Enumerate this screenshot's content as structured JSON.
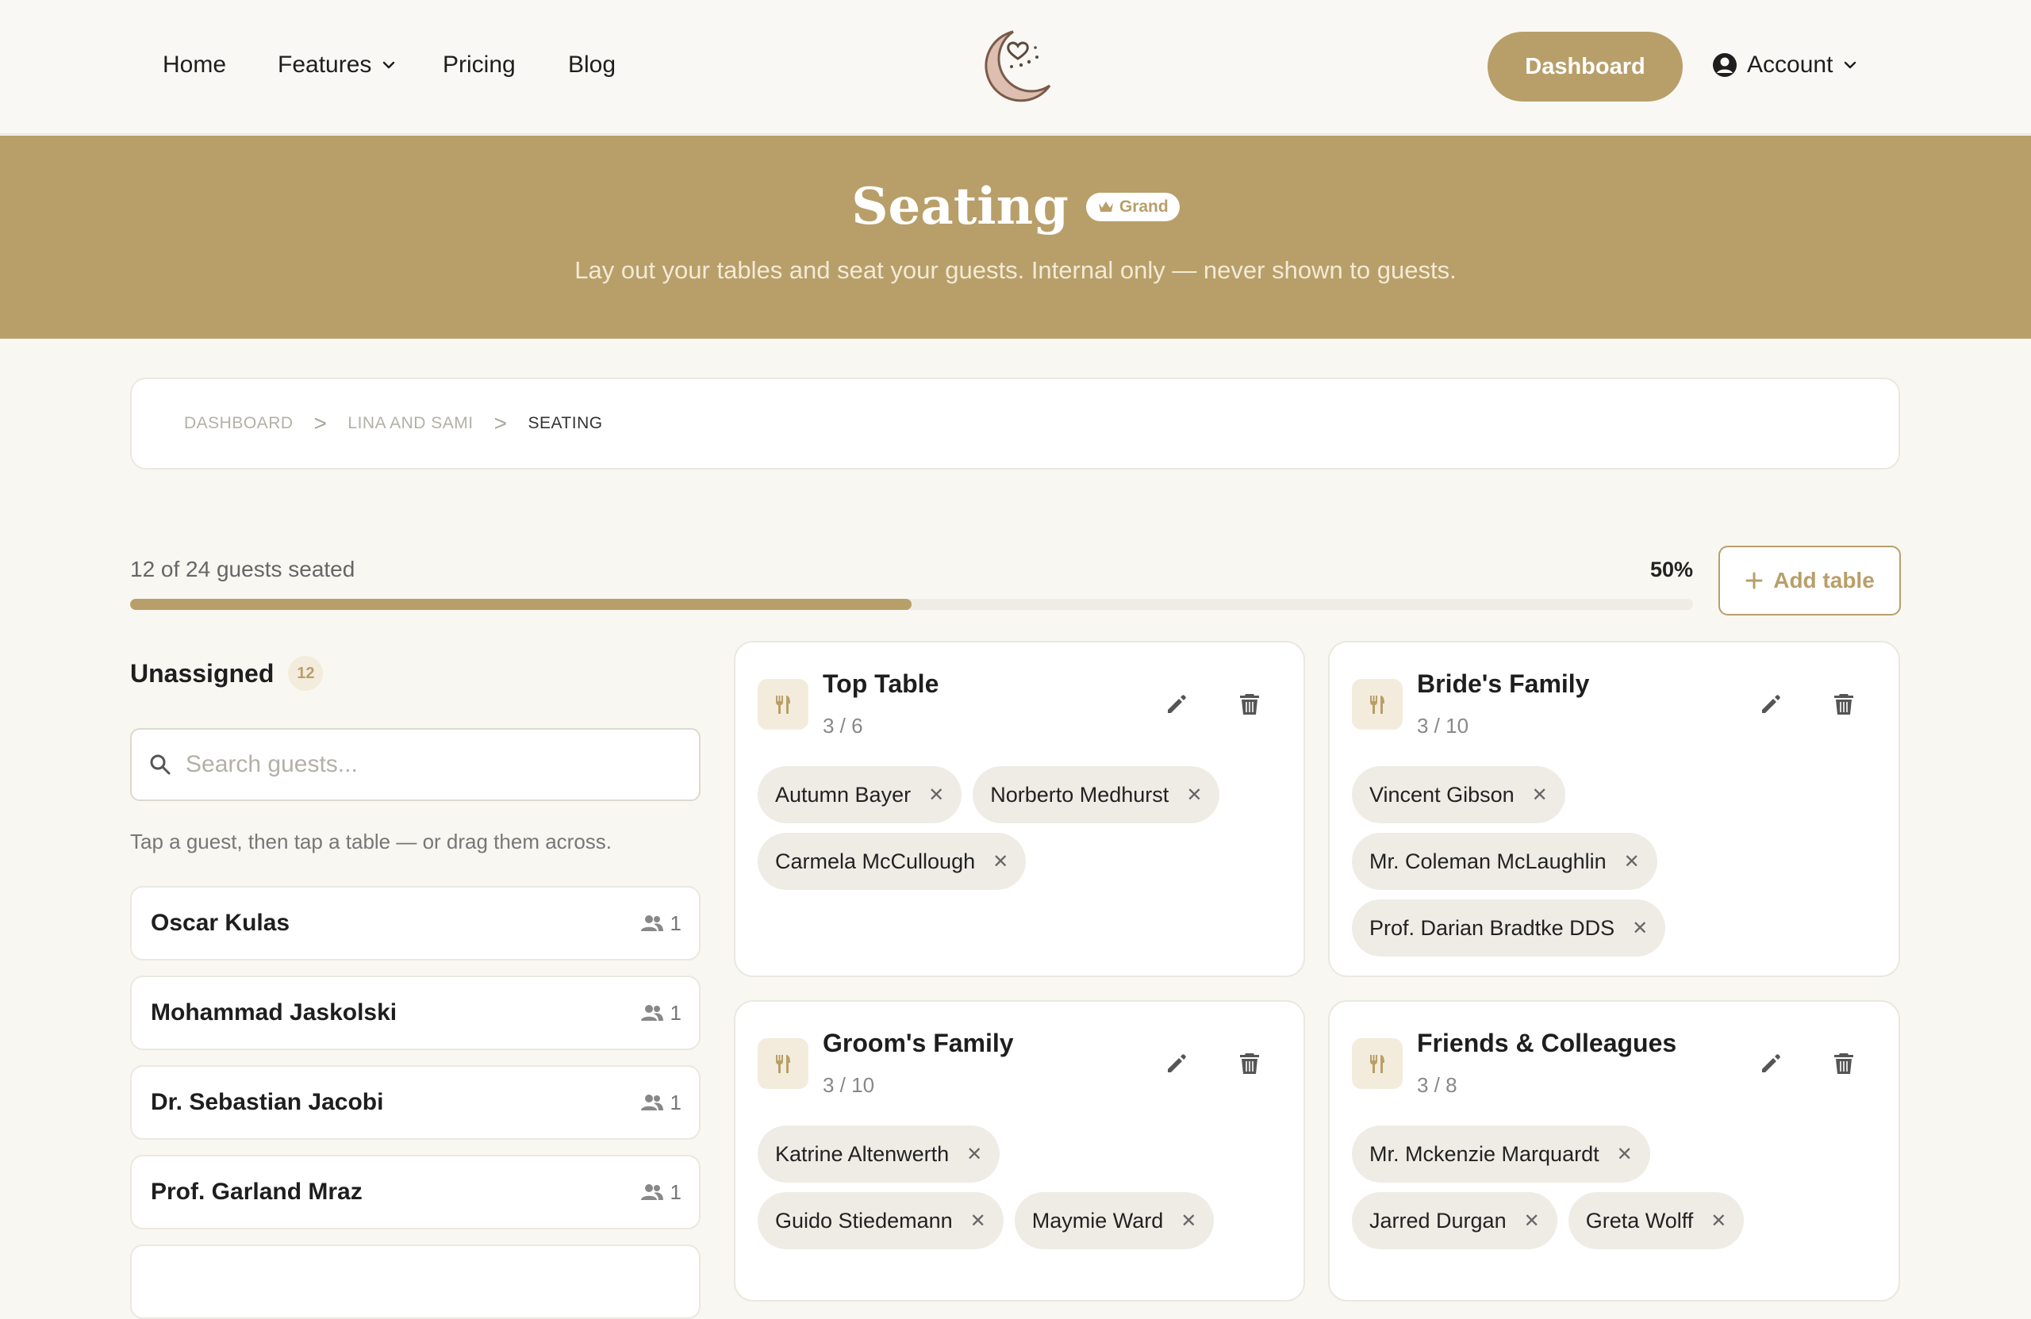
{
  "nav": {
    "home": "Home",
    "features": "Features",
    "pricing": "Pricing",
    "blog": "Blog",
    "dashboard_button": "Dashboard",
    "account": "Account"
  },
  "hero": {
    "title": "Seating",
    "badge": "Grand",
    "subtitle": "Lay out your tables and seat your guests. Internal only — never shown to guests."
  },
  "breadcrumb": {
    "items": [
      "DASHBOARD",
      "LINA AND SAMI",
      "SEATING"
    ],
    "separator": ">"
  },
  "progress": {
    "text": "12 of 24 guests seated",
    "percent_label": "50%",
    "fraction": 0.5
  },
  "add_table_label": "Add table",
  "unassigned": {
    "title": "Unassigned",
    "count": "12",
    "search_placeholder": "Search guests...",
    "hint": "Tap a guest, then tap a table — or drag them across.",
    "guests": [
      {
        "name": "Oscar Kulas",
        "party": "1"
      },
      {
        "name": "Mohammad Jaskolski",
        "party": "1"
      },
      {
        "name": "Dr. Sebastian Jacobi",
        "party": "1"
      },
      {
        "name": "Prof. Garland Mraz",
        "party": "1"
      }
    ]
  },
  "tables": [
    {
      "name": "Top Table",
      "capacity": "3 / 6",
      "guests": [
        "Autumn Bayer",
        "Norberto Medhurst",
        "Carmela McCullough"
      ]
    },
    {
      "name": "Bride's Family",
      "capacity": "3 / 10",
      "guests": [
        "Vincent Gibson",
        "Mr. Coleman McLaughlin",
        "Prof. Darian Bradtke DDS"
      ]
    },
    {
      "name": "Groom's Family",
      "capacity": "3 / 10",
      "guests": [
        "Katrine Altenwerth",
        "Guido Stiedemann",
        "Maymie Ward"
      ]
    },
    {
      "name": "Friends & Colleagues",
      "capacity": "3 / 8",
      "guests": [
        "Mr. Mckenzie Marquardt",
        "Jarred Durgan",
        "Greta Wolff"
      ]
    }
  ],
  "colors": {
    "accent": "#b89f69",
    "background": "#f8f7f2",
    "chip": "#efece6"
  },
  "icons": {
    "logo": "moon-heart-logo",
    "account": "user-circle-icon",
    "table": "utensils-icon",
    "edit": "pencil-icon",
    "delete": "trash-icon",
    "remove": "close-icon",
    "party": "users-icon",
    "search": "search-icon"
  }
}
